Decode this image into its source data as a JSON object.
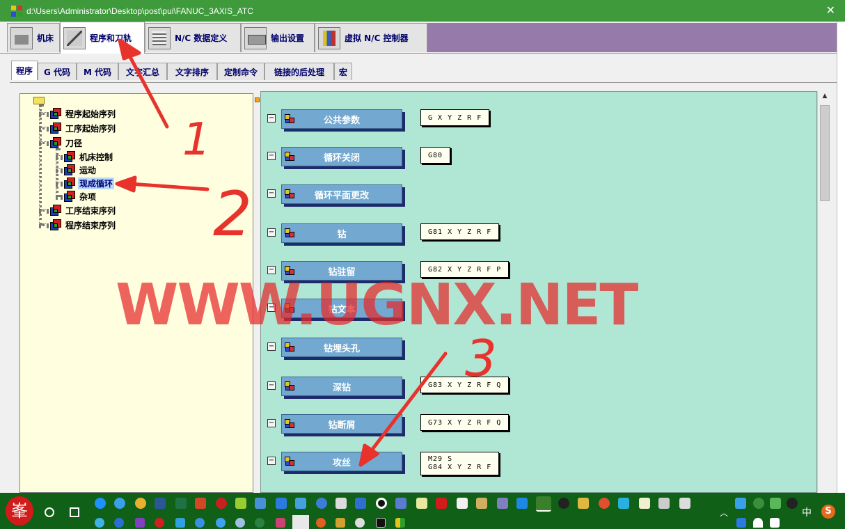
{
  "window": {
    "title": "d:\\Users\\Administrator\\Desktop\\post\\pui\\FANUC_3AXIS_ATC",
    "close_glyph": "✕"
  },
  "main_tabs": [
    {
      "label": "机床",
      "icon": "machine-tool-icon"
    },
    {
      "label": "程序和刀轨",
      "icon": "toolpath-icon",
      "active": true
    },
    {
      "label": "N/C 数据定义",
      "icon": "nc-data-icon"
    },
    {
      "label": "输出设置",
      "icon": "printer-icon"
    },
    {
      "label": "虚拟 N/C 控制器",
      "icon": "virtual-nc-controller-icon"
    }
  ],
  "sub_tabs": [
    {
      "label": "程序",
      "active": true
    },
    {
      "label": "G 代码"
    },
    {
      "label": "M 代码"
    },
    {
      "label": "文字汇总"
    },
    {
      "label": "文字排序"
    },
    {
      "label": "定制命令"
    },
    {
      "label": "链接的后处理"
    },
    {
      "label": "宏"
    }
  ],
  "tree": {
    "items": [
      {
        "label": "程序起始序列"
      },
      {
        "label": "工序起始序列"
      },
      {
        "label": "刀径"
      },
      {
        "label": "机床控制"
      },
      {
        "label": "运动"
      },
      {
        "label": "现成循环",
        "selected": true
      },
      {
        "label": "杂项"
      },
      {
        "label": "工序结束序列"
      },
      {
        "label": "程序结束序列"
      }
    ]
  },
  "cycles": [
    {
      "label": "公共参数",
      "code": "G X Y Z R F"
    },
    {
      "label": "循环关闭",
      "code": "G80"
    },
    {
      "label": "循环平面更改",
      "code": ""
    },
    {
      "label": "钻",
      "code": "G81 X Y Z R F"
    },
    {
      "label": "钻驻留",
      "code": "G82 X Y Z R F P"
    },
    {
      "label": "钻文本",
      "code": ""
    },
    {
      "label": "钻埋头孔",
      "code": ""
    },
    {
      "label": "深钻",
      "code": "G83 X Y Z R F Q"
    },
    {
      "label": "钻断屑",
      "code": "G73 X Y Z R F Q"
    },
    {
      "label": "攻丝",
      "code": "M29 S",
      "code2": "G84 X Y Z R F"
    }
  ],
  "watermark": "WWW.UGNX.NET",
  "annotations": [
    "1",
    "2",
    "3"
  ],
  "annotation_color": "#e8322c",
  "taskbar": {
    "start_glyph": "峯",
    "ime": "中",
    "tray_badge": "S",
    "up_glyph": "︿"
  },
  "colors": {
    "titlebar": "#3f9a3c",
    "panel": "#b0e6d4",
    "button": "#73a8d0",
    "tree_bg": "#ffffe0",
    "taskbar": "#106018"
  }
}
